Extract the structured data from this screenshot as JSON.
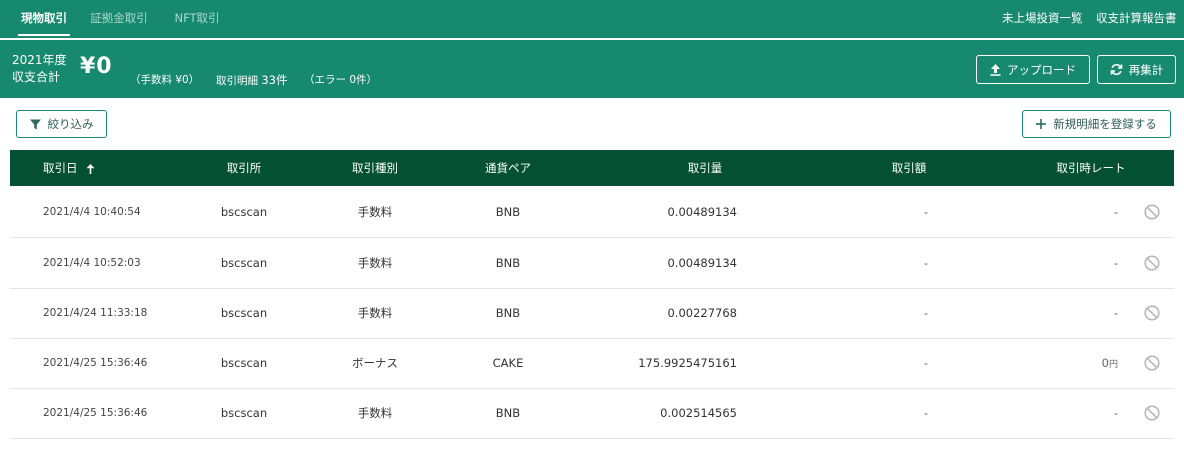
{
  "tabs": [
    {
      "label": "現物取引",
      "active": true
    },
    {
      "label": "証拠金取引",
      "active": false
    },
    {
      "label": "NFT取引",
      "active": false
    }
  ],
  "top_links": {
    "unlisted": "未上場投資一覧",
    "report": "収支計算報告書"
  },
  "summary": {
    "year_line1": "2021年度",
    "year_line2": "収支合計",
    "total": "¥0",
    "fee": "（手数料 ¥0）",
    "count_label": "取引明細",
    "count_value": "33件",
    "errors": "（エラー 0件）"
  },
  "buttons": {
    "upload": "アップロード",
    "recalc": "再集計",
    "filter": "絞り込み",
    "add": "新規明細を登録する"
  },
  "table": {
    "headers": {
      "date": "取引日",
      "exchange": "取引所",
      "type": "取引種別",
      "pair": "通貨ペア",
      "qty": "取引量",
      "amount": "取引額",
      "rate": "取引時レート"
    },
    "rows": [
      {
        "date": "2021/4/4 10:40:54",
        "exchange": "bscscan",
        "type": "手数料",
        "pair": "BNB",
        "qty": "0.00489134",
        "amount": "-",
        "rate": "-",
        "rate_unit": ""
      },
      {
        "date": "2021/4/4 10:52:03",
        "exchange": "bscscan",
        "type": "手数料",
        "pair": "BNB",
        "qty": "0.00489134",
        "amount": "-",
        "rate": "-",
        "rate_unit": ""
      },
      {
        "date": "2021/4/24 11:33:18",
        "exchange": "bscscan",
        "type": "手数料",
        "pair": "BNB",
        "qty": "0.00227768",
        "amount": "-",
        "rate": "-",
        "rate_unit": ""
      },
      {
        "date": "2021/4/25 15:36:46",
        "exchange": "bscscan",
        "type": "ボーナス",
        "pair": "CAKE",
        "qty": "175.9925475161",
        "amount": "-",
        "rate": "0",
        "rate_unit": "円"
      },
      {
        "date": "2021/4/25 15:36:46",
        "exchange": "bscscan",
        "type": "手数料",
        "pair": "BNB",
        "qty": "0.002514565",
        "amount": "-",
        "rate": "-",
        "rate_unit": ""
      }
    ]
  },
  "colors": {
    "primary": "#17896f",
    "header_dark": "#035034"
  },
  "icons": {
    "sort": "arrow-up-icon",
    "upload": "upload-icon",
    "recalc": "refresh-icon",
    "filter": "filter-icon",
    "add": "plus-icon",
    "row_action": "ban-icon"
  }
}
